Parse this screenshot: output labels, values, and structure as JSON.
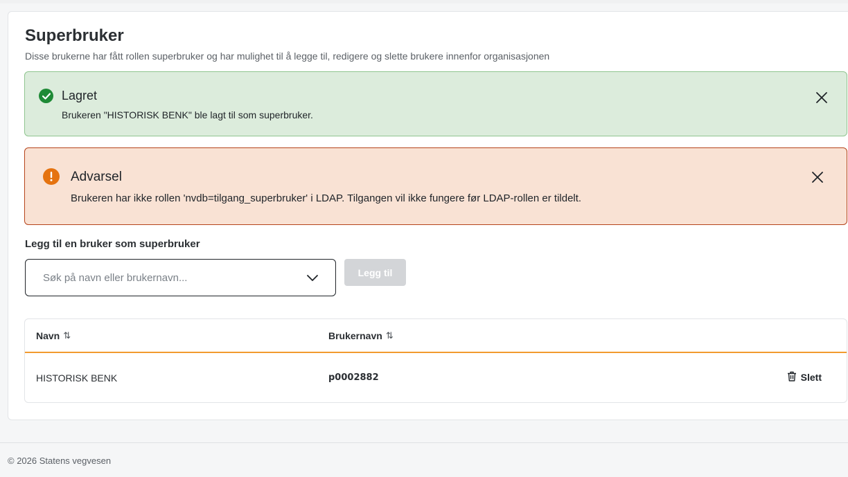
{
  "page": {
    "title": "Superbruker",
    "description": "Disse brukerne har fått rollen superbruker og har mulighet til å legge til, redigere og slette brukere innenfor organisasjonen"
  },
  "alerts": {
    "success": {
      "title": "Lagret",
      "message": "Brukeren \"HISTORISK BENK\" ble lagt til som superbruker.",
      "icon": "check-circle-icon",
      "color": "#1e8a36"
    },
    "warning": {
      "title": "Advarsel",
      "message": "Brukeren har ikke rollen 'nvdb=tilgang_superbruker' i LDAP. Tilgangen vil ikke fungere før LDAP-rollen er tildelt.",
      "icon": "exclamation-circle-icon",
      "color": "#e57310"
    }
  },
  "add_user": {
    "label": "Legg til en bruker som superbruker",
    "search_placeholder": "Søk på navn eller brukernavn...",
    "button_label": "Legg til"
  },
  "table": {
    "columns": [
      "Navn",
      "Brukernavn"
    ],
    "sort_glyph": "⇅",
    "rows": [
      {
        "navn": "HISTORISK BENK",
        "brukernavn": "p0002882",
        "action": "Slett"
      }
    ]
  },
  "footer": {
    "text": "© 2026 Statens vegvesen"
  },
  "colors": {
    "accent_orange": "#f29a2e",
    "success_bg": "#dcecdc",
    "warning_bg": "#f9e2d4",
    "warning_border": "#b5431a"
  }
}
